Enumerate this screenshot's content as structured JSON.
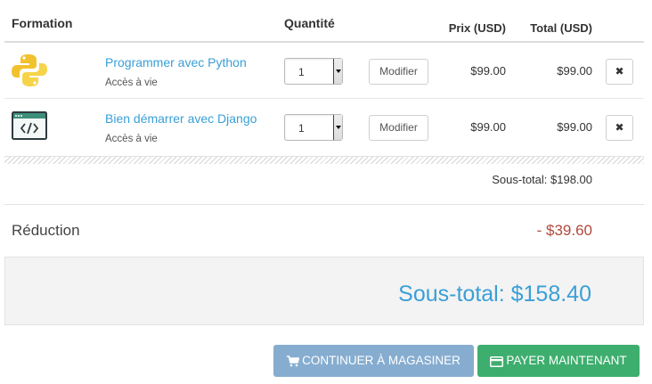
{
  "table": {
    "headers": {
      "course": "Formation",
      "quantity": "Quantité",
      "price": "Prix (USD)",
      "total": "Total (USD)"
    },
    "rows": [
      {
        "icon": "python-logo-icon",
        "name": "Programmer avec Python",
        "access": "Accès à vie",
        "quantity": "1",
        "update_label": "Modifier",
        "price": "$99.00",
        "total": "$99.00",
        "remove_label": "✖"
      },
      {
        "icon": "code-window-icon",
        "name": "Bien démarrer avec Django",
        "access": "Accès à vie",
        "quantity": "1",
        "update_label": "Modifier",
        "price": "$99.00",
        "total": "$99.00",
        "remove_label": "✖"
      }
    ]
  },
  "summary": {
    "subtotal_line": "Sous-total: $198.00",
    "discount_label": "Réduction",
    "discount_value": "- $39.60",
    "grand_total": "Sous-total: $158.40"
  },
  "actions": {
    "continue_label": "CONTINUER À MAGASINER",
    "pay_label": "PAYER MAINTENANT"
  },
  "colors": {
    "link": "#3a9fd6",
    "discount": "#b04a3c",
    "continue_button": "#86add0",
    "pay_button": "#3eae6e"
  }
}
